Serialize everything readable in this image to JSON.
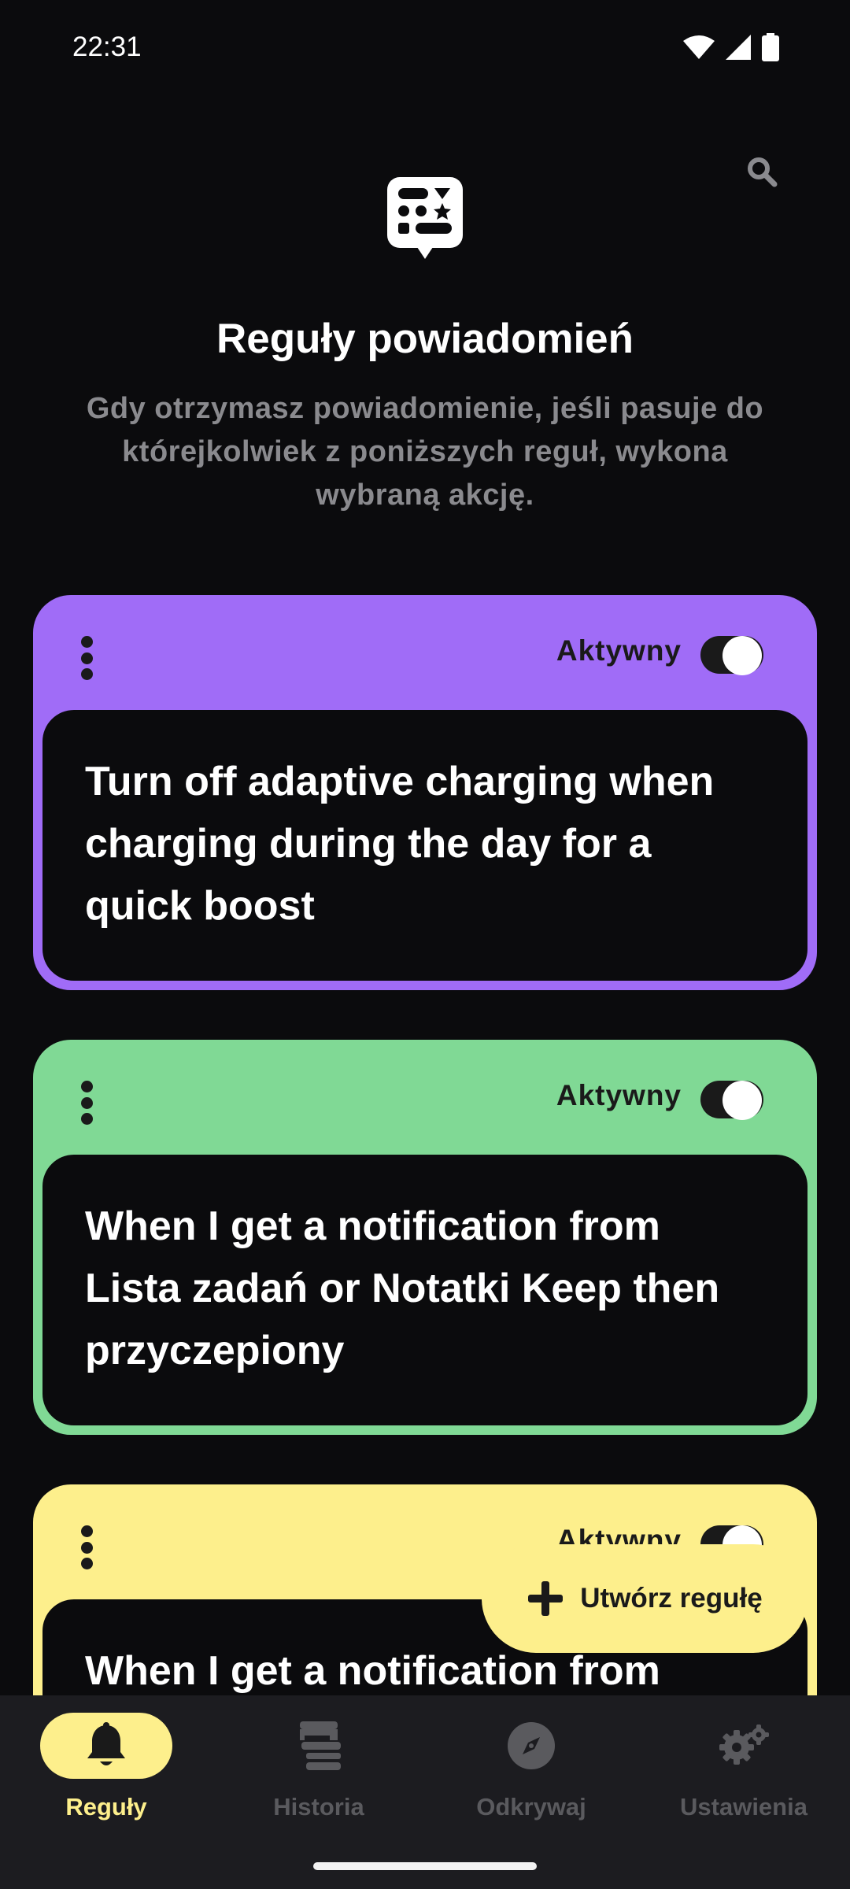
{
  "status_bar": {
    "time": "22:31"
  },
  "header": {
    "title": "Reguły powiadomień",
    "description": "Gdy otrzymasz powiadomienie, jeśli pasuje do którejkolwiek z poniższych reguł, wykona wybraną akcję."
  },
  "rules": [
    {
      "status_label": "Aktywny",
      "enabled": true,
      "color": "#a06cf7",
      "text": "Turn off adaptive charging when charging during the day for a quick boost"
    },
    {
      "status_label": "Aktywny",
      "enabled": true,
      "color": "#80d995",
      "text": "When I get a notification from Lista zadań or Notatki Keep then przyczepiony"
    },
    {
      "status_label": "Aktywny",
      "enabled": true,
      "color": "#fdef8c",
      "text": "When I get a notification from"
    }
  ],
  "fab": {
    "label": "Utwórz regułę",
    "icon": "plus-icon"
  },
  "bottom_nav": {
    "items": [
      {
        "label": "Reguły",
        "icon": "bell-icon",
        "active": true
      },
      {
        "label": "Historia",
        "icon": "history-icon",
        "active": false
      },
      {
        "label": "Odkrywaj",
        "icon": "compass-icon",
        "active": false
      },
      {
        "label": "Ustawienia",
        "icon": "gears-icon",
        "active": false
      }
    ]
  },
  "colors": {
    "background": "#0b0b0d",
    "accent_yellow": "#fdef8c",
    "purple": "#a06cf7",
    "green": "#80d995"
  }
}
